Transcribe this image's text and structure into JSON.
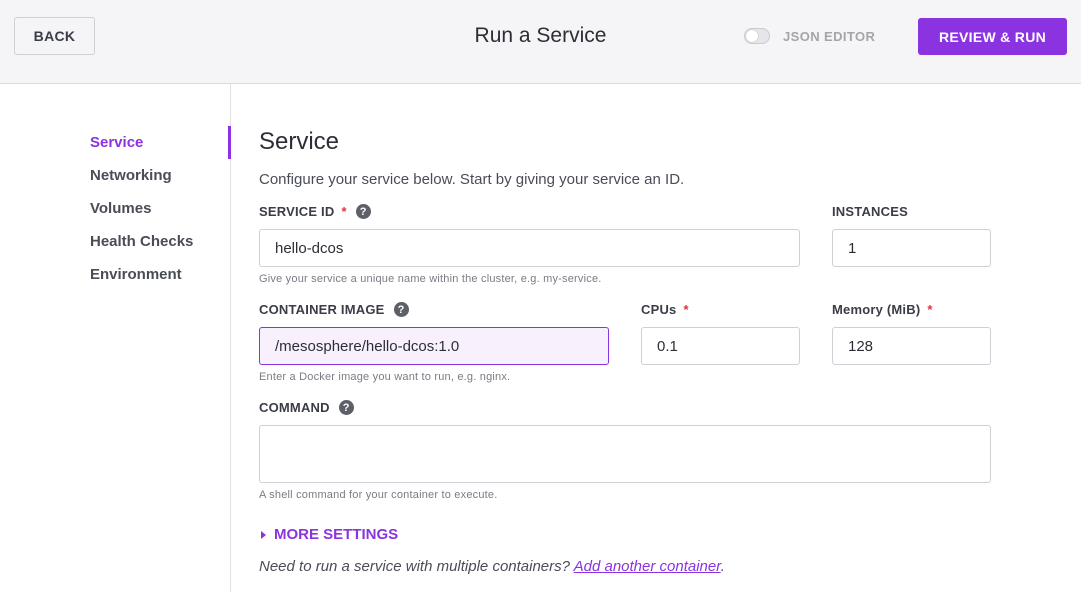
{
  "header": {
    "back_label": "BACK",
    "title": "Run a Service",
    "json_editor_label": "JSON EDITOR",
    "review_run_label": "REVIEW & RUN"
  },
  "sidebar": {
    "items": [
      {
        "label": "Service",
        "active": true
      },
      {
        "label": "Networking",
        "active": false
      },
      {
        "label": "Volumes",
        "active": false
      },
      {
        "label": "Health Checks",
        "active": false
      },
      {
        "label": "Environment",
        "active": false
      }
    ]
  },
  "main": {
    "title": "Service",
    "description": "Configure your service below. Start by giving your service an ID.",
    "service_id": {
      "label": "SERVICE ID",
      "required": "*",
      "value": "hello-dcos",
      "hint": "Give your service a unique name within the cluster, e.g. my-service."
    },
    "instances": {
      "label": "INSTANCES",
      "value": "1"
    },
    "container_image": {
      "label": "CONTAINER IMAGE",
      "value": "/mesosphere/hello-dcos:1.0",
      "hint": "Enter a Docker image you want to run, e.g. nginx."
    },
    "cpus": {
      "label": "CPUs",
      "required": "*",
      "value": "0.1"
    },
    "memory": {
      "label": "Memory (MiB)",
      "required": "*",
      "value": "128"
    },
    "command": {
      "label": "COMMAND",
      "value": "",
      "hint": "A shell command for your container to execute."
    },
    "more_settings_label": "MORE SETTINGS",
    "footer_text": "Need to run a service with multiple containers?",
    "footer_link": "Add another container",
    "footer_end": "."
  },
  "colors": {
    "accent": "#8b33e0",
    "required": "#e5303f"
  },
  "icons": {
    "help": "?"
  }
}
